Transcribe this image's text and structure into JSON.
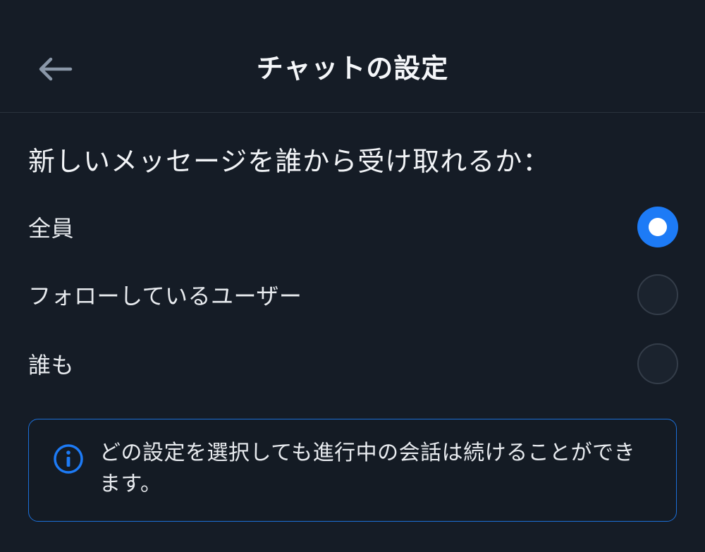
{
  "header": {
    "title": "チャットの設定",
    "back_icon": "arrow-left-icon"
  },
  "settings": {
    "heading": "新しいメッセージを誰から受け取れるか：",
    "options": [
      {
        "label": "全員",
        "selected": true
      },
      {
        "label": "フォローしているユーザー",
        "selected": false
      },
      {
        "label": "誰も",
        "selected": false
      }
    ]
  },
  "info": {
    "icon": "info-icon",
    "text": "どの設定を選択しても進行中の会話は続けることができます。"
  },
  "colors": {
    "background": "#151c26",
    "accent": "#1d7bf6",
    "divider": "#2a323d"
  }
}
